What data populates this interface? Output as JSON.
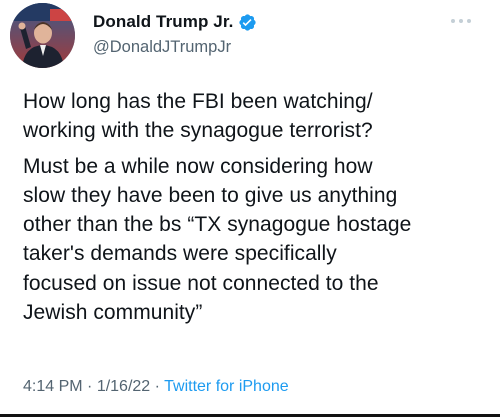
{
  "author": {
    "display_name": "Donald Trump Jr.",
    "handle": "@DonaldJTrumpJr",
    "verified": true
  },
  "tweet": {
    "paragraphs": [
      "How long has the FBI been watching/\nworking with the synagogue terrorist?",
      "Must be a while now considering how\nslow they have been to give us anything\nother than the bs “TX synagogue hostage\ntaker's demands were specifically\nfocused on issue not connected to the\nJewish community”"
    ]
  },
  "meta": {
    "time": "4:14 PM",
    "separator1": " · ",
    "date": "1/16/22",
    "separator2": " · ",
    "source": "Twitter for iPhone"
  },
  "colors": {
    "text": "#0f1419",
    "secondary": "#536471",
    "accent": "#1d9bf0"
  },
  "icons": {
    "verified": "verified-badge-icon",
    "more": "more-options-icon"
  }
}
